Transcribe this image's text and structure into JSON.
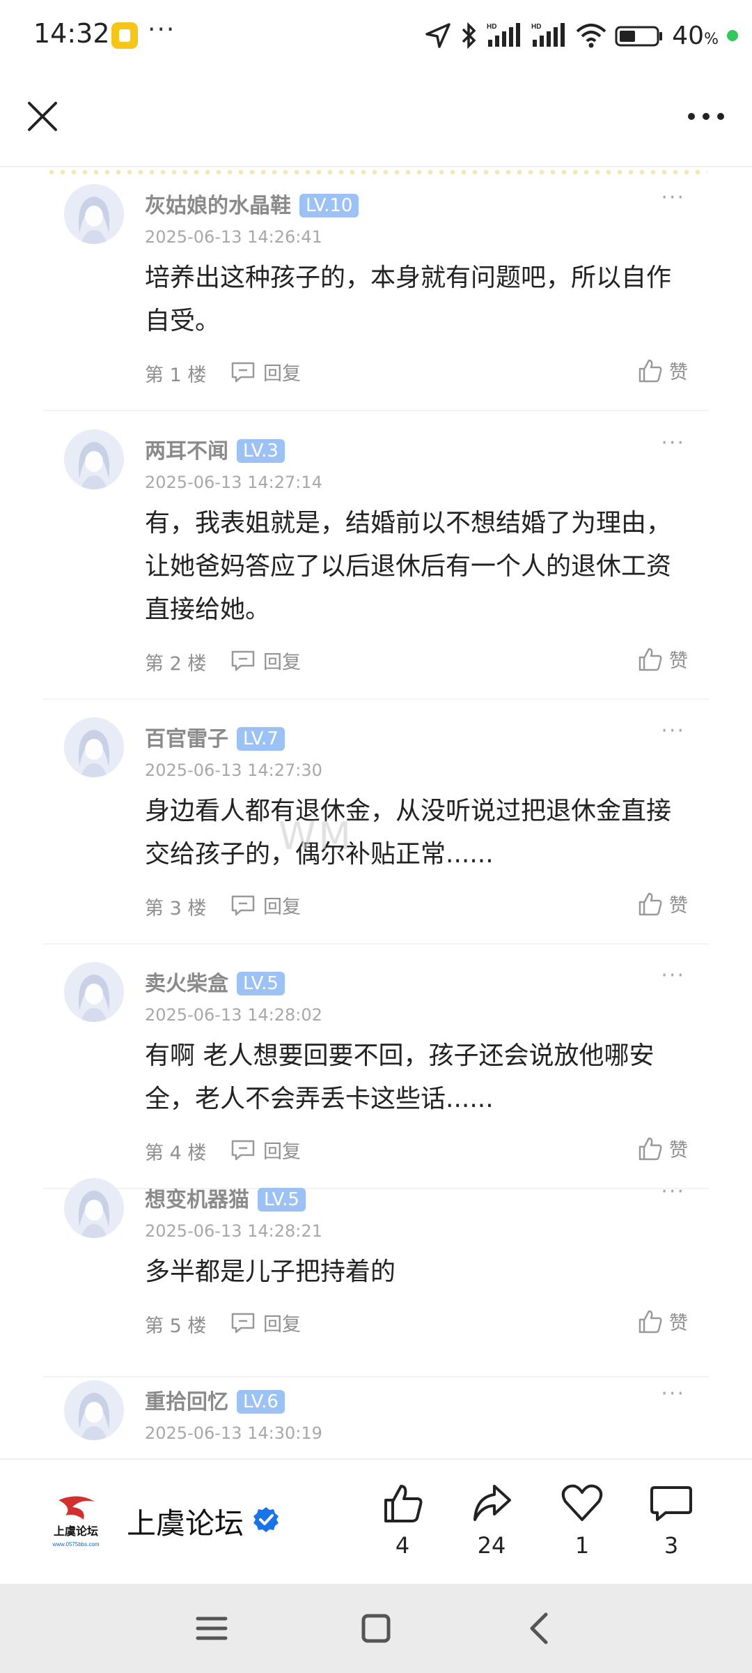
{
  "status_bar": {
    "time": "14:32",
    "battery": "40",
    "battery_unit": "%"
  },
  "comments": [
    {
      "user": "灰姑娘的水晶鞋",
      "level": "LV.10",
      "time": "2025-06-13 14:26:41",
      "text": "培养出这种孩子的，本身就有问题吧，所以自作自受。",
      "floor": "第 1 楼",
      "reply": "回复",
      "like": "赞"
    },
    {
      "user": "两耳不闻",
      "level": "LV.3",
      "time": "2025-06-13 14:27:14",
      "text": "有，我表姐就是，结婚前以不想结婚了为理由，让她爸妈答应了以后退休后有一个人的退休工资直接给她。",
      "floor": "第 2 楼",
      "reply": "回复",
      "like": "赞"
    },
    {
      "user": "百官雷子",
      "level": "LV.7",
      "time": "2025-06-13 14:27:30",
      "text": "身边看人都有退休金，从没听说过把退休金直接交给孩子的，偶尔补贴正常......",
      "floor": "第 3 楼",
      "reply": "回复",
      "like": "赞"
    },
    {
      "user": "卖火柴盒",
      "level": "LV.5",
      "time": "2025-06-13 14:28:02",
      "text": "有啊 老人想要回要不回，孩子还会说放他哪安全，老人不会弄丢卡这些话......",
      "floor": "第 4 楼",
      "reply": "回复",
      "like": "赞"
    },
    {
      "user": "想变机器猫",
      "level": "LV.5",
      "time": "2025-06-13 14:28:21",
      "text": "多半都是儿子把持着的",
      "floor": "第 5 楼",
      "reply": "回复",
      "like": "赞"
    },
    {
      "user": "重拾回忆",
      "level": "LV.6",
      "time": "2025-06-13 14:30:19"
    }
  ],
  "bottom_bar": {
    "forum_name": "上虞论坛",
    "logo_text": "上虞论坛",
    "logo_url_text": "www.0575bbs.com",
    "actions": [
      {
        "icon": "thumbs-up-icon",
        "count": "4"
      },
      {
        "icon": "share-icon",
        "count": "24"
      },
      {
        "icon": "heart-icon",
        "count": "1"
      },
      {
        "icon": "comment-icon",
        "count": "3"
      }
    ]
  },
  "colors": {
    "level_badge": "#9cc2f5",
    "verified": "#1a73e8",
    "status_dot": "#34c759"
  }
}
